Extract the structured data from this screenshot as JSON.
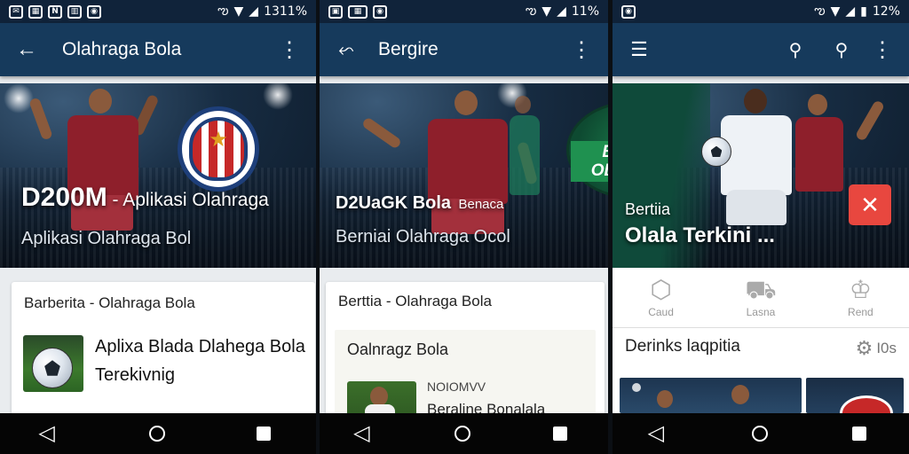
{
  "screens": [
    {
      "status": {
        "time": "1311%"
      },
      "appbar": {
        "title": "Olahraga Bola"
      },
      "hero": {
        "title": "D200M",
        "title_rest": " - Aplikasi Olahraga",
        "subtitle": "Aplikasi Olahraga Bol"
      },
      "card": {
        "header": "Barberita - Olahraga Bola",
        "item_title": "Aplixa Blada Dlahega Bola",
        "item_subtitle": "Terekivnig"
      }
    },
    {
      "status": {
        "time": "11%"
      },
      "appbar": {
        "title": "Bergire"
      },
      "hero": {
        "title": "D2UaGK Bola",
        "title_small": "Benaca",
        "subtitle": "Berniai Olahraga Ocol",
        "badge_text": "BIVRM\nOLAHIHA"
      },
      "card": {
        "header": "Berttia - Olahraga Bola",
        "inner_title": "Oalnragz Bola",
        "inner_item_caption": "NOIOMVV",
        "inner_item_title": "Beraline Bonalala"
      }
    },
    {
      "status": {
        "time": "12%"
      },
      "hero": {
        "subtitle": "Bertiia",
        "title": "Olala Terkini ..."
      },
      "categories": [
        {
          "label": "Caud",
          "icon": "shield-icon"
        },
        {
          "label": "Lasna",
          "icon": "cart-icon"
        },
        {
          "label": "Rend",
          "icon": "trophy-icon"
        }
      ],
      "section": {
        "title": "Derinks laqpitia",
        "count": "I0s"
      }
    }
  ],
  "colors": {
    "appbar": "#163a5c",
    "statusbar": "#10233a",
    "accent_red": "#e8473f",
    "jersey_red": "#8e1f2b"
  }
}
